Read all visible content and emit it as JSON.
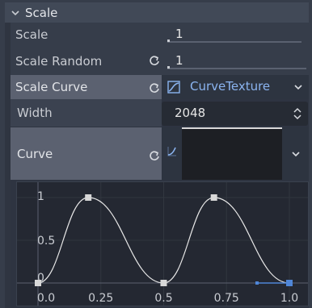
{
  "section": {
    "title": "Scale"
  },
  "rows": {
    "scale": {
      "label": "Scale",
      "value": "1"
    },
    "scale_random": {
      "label": "Scale Random",
      "value": "1"
    },
    "scale_curve": {
      "label": "Scale Curve",
      "resource": "CurveTexture"
    },
    "width": {
      "label": "Width",
      "value": "2048"
    },
    "curve": {
      "label": "Curve"
    }
  },
  "chart_data": {
    "type": "line",
    "x_ticks": [
      "0.0",
      "0.25",
      "0.5",
      "0.75",
      "1.0"
    ],
    "y_ticks": [
      "0",
      "0.5",
      "1"
    ],
    "xlim": [
      0,
      1
    ],
    "ylim": [
      0,
      1
    ],
    "points": [
      {
        "x": 0.0,
        "y": 0.0
      },
      {
        "x": 0.2,
        "y": 1.0
      },
      {
        "x": 0.5,
        "y": 0.0
      },
      {
        "x": 0.7,
        "y": 1.0
      },
      {
        "x": 1.0,
        "y": 0.0
      }
    ],
    "grid": true
  },
  "colors": {
    "accent": "#8bb4f0",
    "handle": "#4f86d8"
  },
  "icons": {
    "collapse": "chevron-down-icon",
    "revert": "revert-icon",
    "resource": "curve-texture-icon",
    "dropdown": "chevron-down-icon",
    "stepper": "up-down-arrows-icon"
  }
}
